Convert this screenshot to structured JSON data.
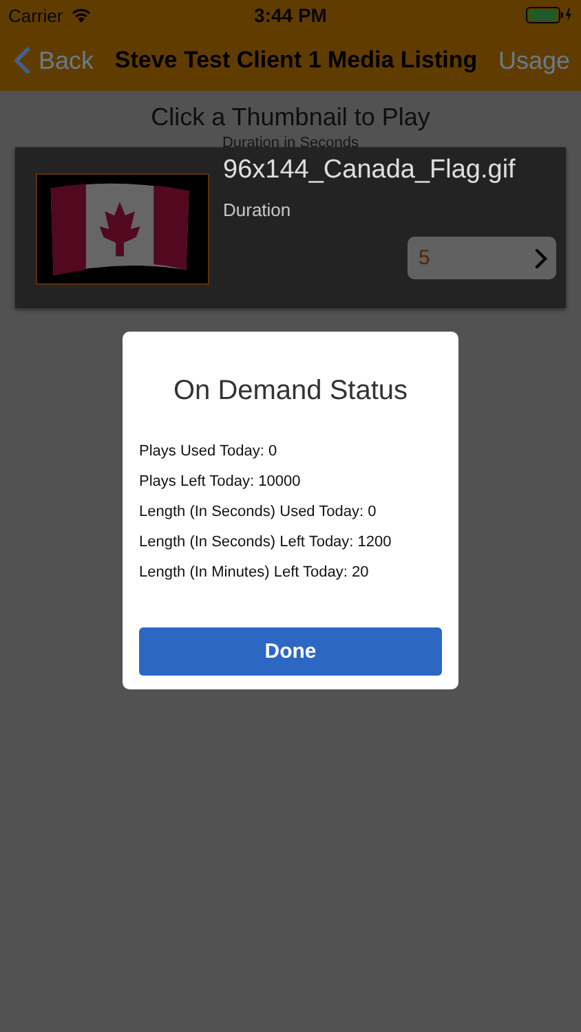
{
  "status_bar": {
    "carrier": "Carrier",
    "time": "3:44 PM"
  },
  "nav": {
    "back": "Back",
    "title": "Steve Test Client 1 Media Listing",
    "action": "Usage"
  },
  "header": {
    "title": "Click a Thumbnail to Play",
    "subtitle": "Duration in Seconds"
  },
  "media_items": [
    {
      "name": "96x144_Canada_Flag.gif",
      "duration_label": "Duration",
      "duration": "5"
    }
  ],
  "dialog": {
    "title": "On Demand Status",
    "lines": [
      "Plays Used Today: 0",
      "Plays Left Today: 10000",
      "Length (In Seconds) Used Today: 0",
      "Length (In Seconds) Left Today: 1200",
      "Length (In Minutes) Left Today: 20"
    ],
    "button": "Done"
  }
}
